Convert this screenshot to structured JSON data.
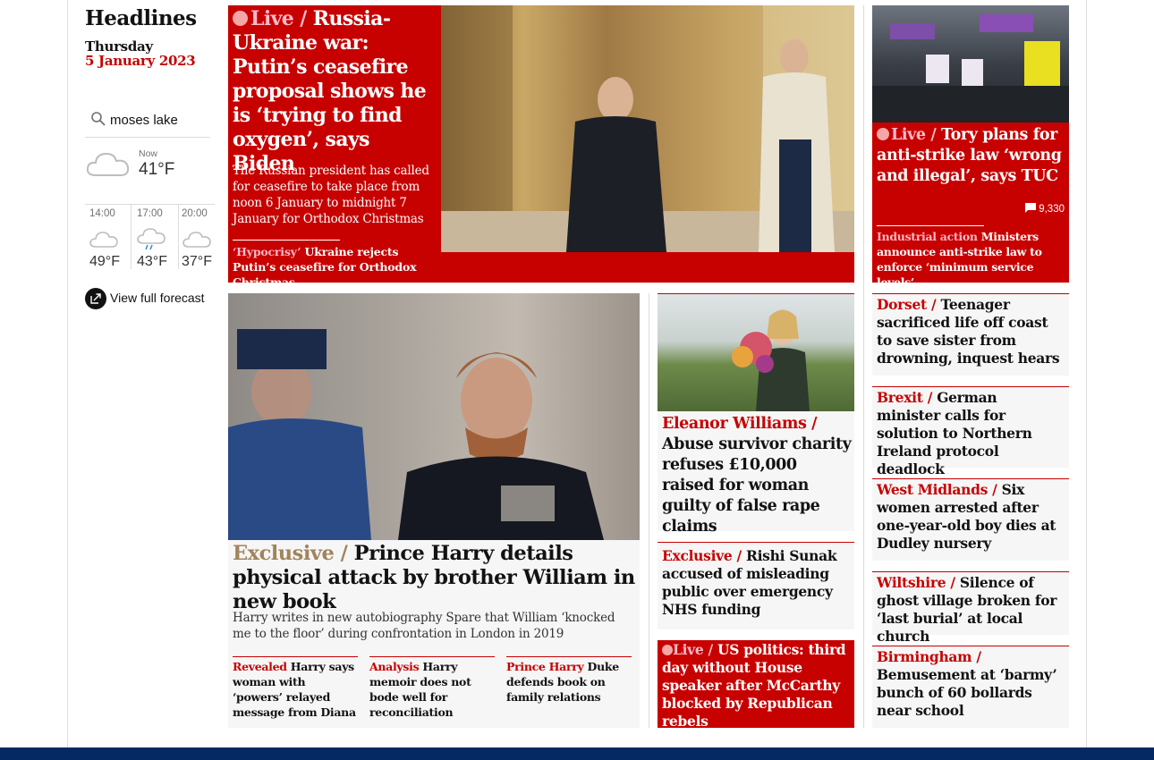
{
  "sidebar": {
    "title": "Headlines",
    "day": "Thursday",
    "date": "5 January 2023",
    "search_location": "moses lake",
    "weather": {
      "now_label": "Now",
      "now_temp": "41°F",
      "forecast": [
        {
          "time": "14:00",
          "temp": "49°F",
          "icon": "cloud-icon"
        },
        {
          "time": "17:00",
          "temp": "43°F",
          "icon": "rain-cloud-icon"
        },
        {
          "time": "20:00",
          "temp": "37°F",
          "icon": "cloud-icon"
        }
      ],
      "full_forecast_label": "View full forecast"
    }
  },
  "lead": {
    "live_label": "Live /",
    "headline": "Russia-Ukraine war: Putin’s ceasefire proposal shows he is ‘trying to find oxygen’, says Biden",
    "standfirst": "The Russian president has called for ceasefire to take place from noon 6 January to midnight 7 January for Orthodox Christmas",
    "sublink_kicker": "‘Hypocrisy’",
    "sublink_text": "Ukraine rejects Putin’s ceasefire for Orthodox Christmas"
  },
  "strike": {
    "live_label": "Live /",
    "headline": "Tory plans for anti-strike law ‘wrong and illegal’, says TUC",
    "comments": "9,330",
    "sublink_kicker": "Industrial action",
    "sublink_text": "Ministers announce anti-strike law to enforce ‘minimum service levels’"
  },
  "harry": {
    "kicker": "Exclusive /",
    "headline": "Prince Harry details physical attack by brother William in new book",
    "standfirst": "Harry writes in new autobiography Spare that William ‘knocked me to the floor’ during confrontation in London in 2019",
    "sublinks": [
      {
        "kicker": "Revealed",
        "text": "Harry says woman with ‘powers’ relayed message from Diana"
      },
      {
        "kicker": "Analysis",
        "text": "Harry memoir does not bode well for reconciliation"
      },
      {
        "kicker": "Prince Harry",
        "text": "Duke defends book on family relations"
      }
    ]
  },
  "eleanor": {
    "kicker": "Eleanor Williams /",
    "headline": "Abuse survivor charity refuses £10,000 raised for woman guilty of false rape claims"
  },
  "sunak": {
    "kicker": "Exclusive /",
    "headline": "Rishi Sunak accused of misleading public over emergency NHS funding"
  },
  "uspolitics": {
    "live_label": "Live /",
    "headline": "US politics: third day without House speaker after McCarthy blocked by Republican rebels"
  },
  "right_column": [
    {
      "kicker": "Dorset /",
      "headline": "Teenager sacrificed life off coast to save sister from drowning, inquest hears"
    },
    {
      "kicker": "Brexit /",
      "headline": "German minister calls for solution to Northern Ireland protocol deadlock"
    },
    {
      "kicker": "West Midlands /",
      "headline": "Six women arrested after one-year-old boy dies at Dudley nursery"
    },
    {
      "kicker": "Wiltshire /",
      "headline": "Silence of ghost village broken for ‘last burial’ at local church"
    },
    {
      "kicker": "Birmingham /",
      "headline": "Bemusement at ‘barmy’ bunch of 60 bollards near school"
    }
  ],
  "colors": {
    "news_red": "#c70000",
    "lead_bg": "#c70000",
    "card_bg": "#f6f6f6",
    "exclusive_gold": "#a1845c",
    "footer_navy": "#052962"
  }
}
